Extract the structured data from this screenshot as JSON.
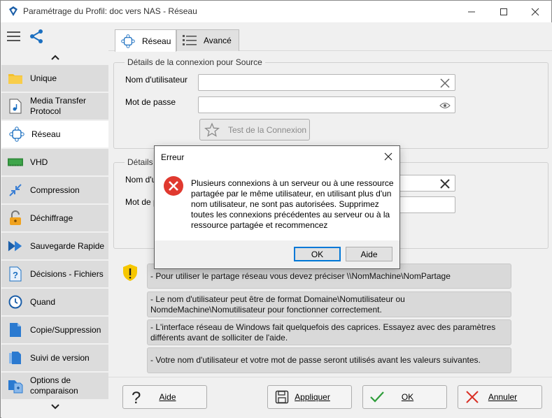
{
  "window": {
    "title": "Paramétrage du Profil: doc vers NAS - Réseau",
    "controls": [
      "minimize",
      "maximize",
      "close"
    ]
  },
  "sidebar": {
    "items": [
      {
        "label": "Unique",
        "icon": "folder-icon"
      },
      {
        "label": "Media Transfer Protocol",
        "icon": "media-file-icon"
      },
      {
        "label": "Réseau",
        "icon": "network-icon",
        "active": true
      },
      {
        "label": "VHD",
        "icon": "vhd-icon"
      },
      {
        "label": "Compression",
        "icon": "compress-icon"
      },
      {
        "label": "Déchiffrage",
        "icon": "unlock-icon"
      },
      {
        "label": "Sauvegarde Rapide",
        "icon": "fast-forward-icon"
      },
      {
        "label": "Décisions - Fichiers",
        "icon": "question-file-icon"
      },
      {
        "label": "Quand",
        "icon": "clock-icon"
      },
      {
        "label": "Copie/Suppression",
        "icon": "file-icon"
      },
      {
        "label": "Suivi de version",
        "icon": "versions-icon"
      },
      {
        "label": "Options de comparaison",
        "icon": "compare-icon"
      }
    ]
  },
  "tabs": [
    {
      "label": "Réseau",
      "active": true
    },
    {
      "label": "Avancé",
      "active": false
    }
  ],
  "source_group": {
    "legend": "Détails de la connexion pour Source",
    "username_label": "Nom d'utilisateur",
    "username_value": "",
    "password_label": "Mot de passe",
    "password_value": "",
    "test_button": "Test de la Connexion"
  },
  "dest_group": {
    "legend": "Détails",
    "username_label": "Nom d'u",
    "password_label": "Mot de p"
  },
  "tips": [
    "- Pour utiliser le partage réseau vous devez préciser \\\\NomMachine\\NomPartage",
    "- Le nom d'utilisateur peut être de format Domaine\\Nomutilisateur ou NomdeMachine\\Nomutilisateur pour fonctionner correctement.",
    "- L'interface réseau de Windows fait quelquefois des caprices. Essayez avec des paramètres différents avant de solliciter de l'aide.",
    "- Votre nom d'utilisateur et votre mot de passe seront utilisés avant les valeurs suivantes."
  ],
  "bottom_buttons": {
    "help": "Aide",
    "apply": "Appliquer",
    "ok": "OK",
    "cancel": "Annuler"
  },
  "dialog": {
    "title": "Erreur",
    "message": "Plusieurs connexions à un serveur ou à une ressource partagée par le même utilisateur, en utilisant plus d'un nom utilisateur, ne sont pas autorisées. Supprimez toutes les connexions précédentes au serveur ou à la ressource partagée et recommencez",
    "ok": "OK",
    "help": "Aide"
  },
  "colors": {
    "accent": "#0078d7",
    "error": "#e0392f",
    "ok_check": "#2e9d3a",
    "cancel_x": "#d93025"
  }
}
